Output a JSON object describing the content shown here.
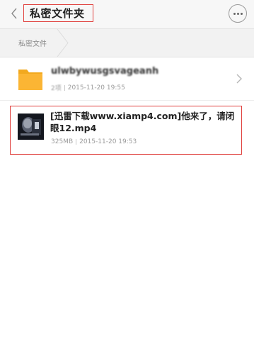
{
  "header": {
    "title": "私密文件夹",
    "back_icon": "chevron-left-icon",
    "more_icon": "more-dots-icon"
  },
  "breadcrumb": {
    "items": [
      {
        "label": "私密文件"
      }
    ]
  },
  "files": [
    {
      "type": "folder",
      "name": "ulwbywusgsvageanh",
      "count": "2项",
      "date": "2015-11-20 19:55",
      "icon": "folder-icon",
      "color": "#fbb534"
    },
    {
      "type": "video",
      "name": "[迅雷下载www.xiamp4.com]他来了，请闭眼12.mp4",
      "size": "325MB",
      "date": "2015-11-20 19:53",
      "icon": "video-thumbnail"
    }
  ],
  "colors": {
    "highlight": "#e0413e",
    "folder": "#fbb534",
    "background": "#f7f7f7"
  }
}
